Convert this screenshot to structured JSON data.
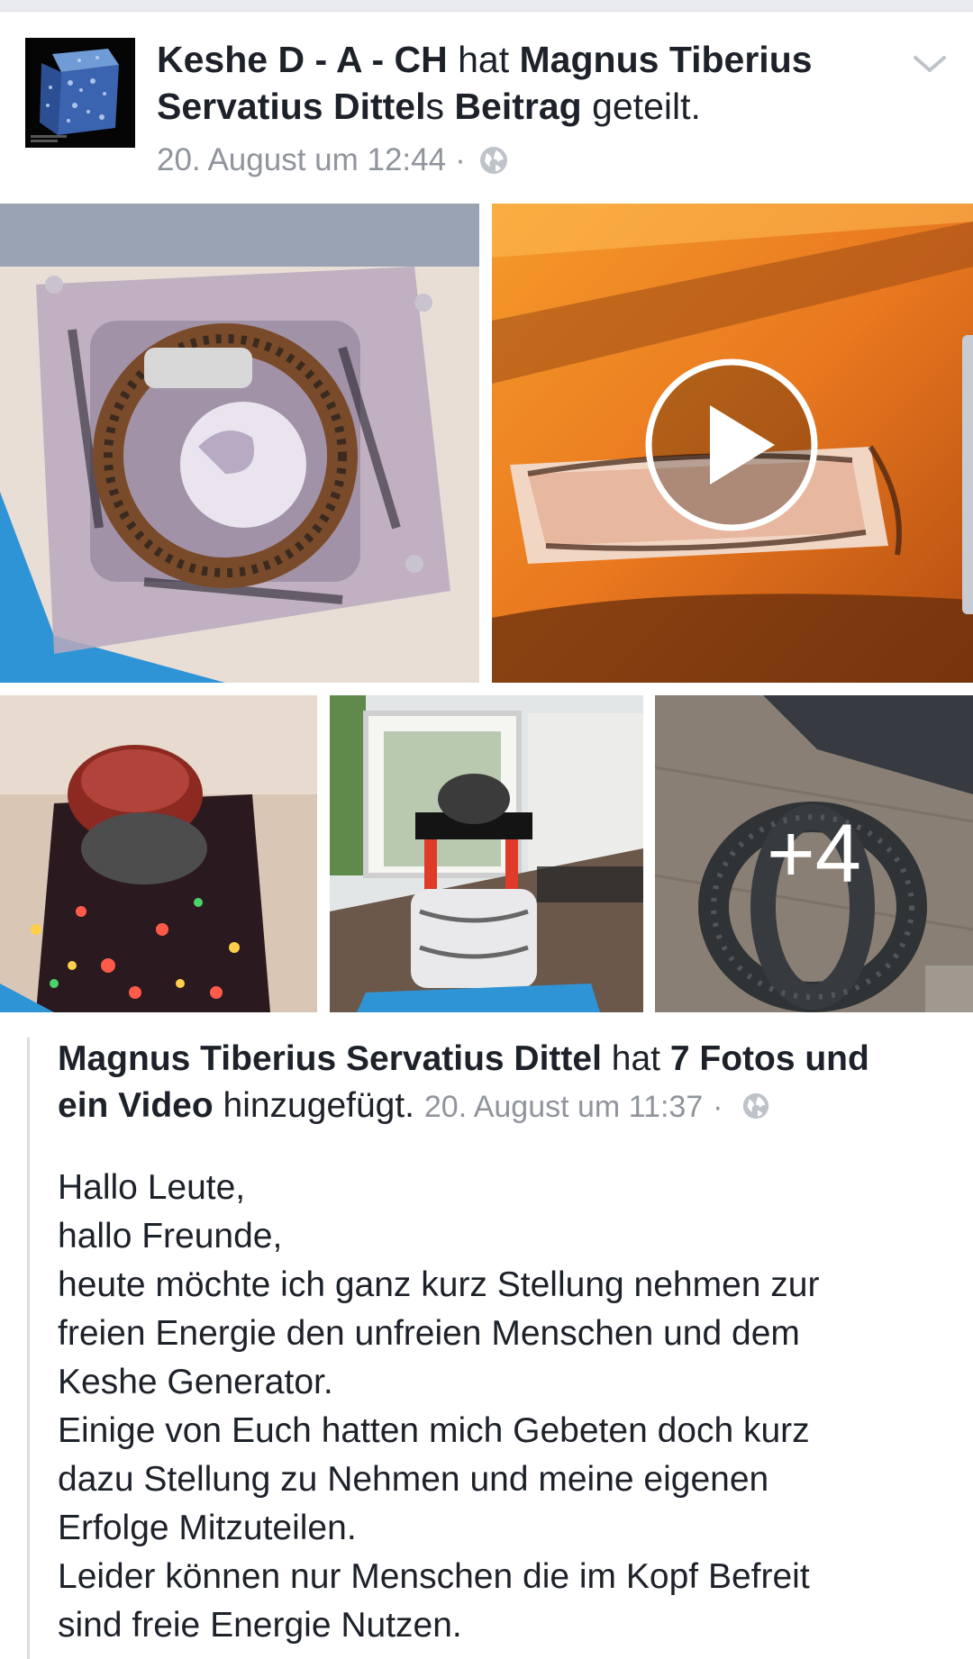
{
  "post": {
    "sharer": "Keshe D - A - CH",
    "verb_hat": "hat",
    "original_author_part1": "Magnus Tiberius",
    "original_author_part2": "Servatius Dittel",
    "possessive": "s",
    "beitrag": "Beitrag",
    "action": "geteilt.",
    "timestamp": "20. August um 12:44",
    "separator": "·",
    "privacy_icon": "globe-icon",
    "options_icon": "chevron-down-icon"
  },
  "gallery": {
    "more_count_label": "+4",
    "video_icon": "play-icon"
  },
  "shared": {
    "author": "Magnus Tiberius Servatius Dittel",
    "verb_hat": "hat",
    "what": "7 Fotos und ein Video",
    "action": "hinzugefügt.",
    "timestamp": "20. August um 11:37",
    "separator": "·",
    "privacy_icon": "globe-icon"
  },
  "body_lines": [
    "Hallo Leute,",
    "hallo Freunde,",
    "heute möchte ich ganz kurz Stellung nehmen zur",
    "freien Energie den unfreien Menschen und dem",
    "Keshe Generator.",
    "Einige von Euch hatten mich Gebeten doch kurz",
    "dazu Stellung zu Nehmen und meine eigenen",
    "Erfolge Mitzuteilen.",
    "Leider können nur Menschen die im Kopf Befreit",
    "sind freie Energie Nutzen."
  ],
  "colors": {
    "text": "#1d2129",
    "meta": "#90949c",
    "divider": "#dadde1"
  }
}
